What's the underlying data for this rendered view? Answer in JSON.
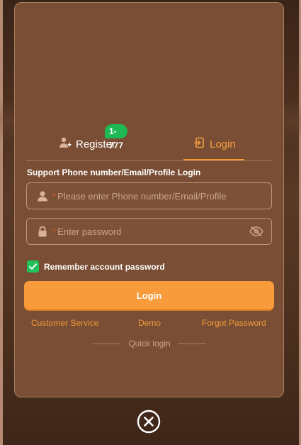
{
  "tabs": {
    "register_label": "Register",
    "register_badge": "1-777",
    "login_label": "Login"
  },
  "form": {
    "support_text": "Support Phone number/Email/Profile Login",
    "phone_required": "*",
    "phone_placeholder": "Please enter Phone number/Email/Profile",
    "password_required": "*",
    "password_placeholder": "Enter password",
    "remember_label": "Remember account password",
    "remember_checked": true,
    "login_button": "Login"
  },
  "links": {
    "customer_service": "Customer Service",
    "demo": "Demo",
    "forgot_password": "Forgot Password"
  },
  "quick_login": "Quick login",
  "colors": {
    "accent": "#f89b3a",
    "badge": "#1db954",
    "checkbox": "#20c05a",
    "modal_bg": "#7a4e34"
  },
  "icons": [
    "add-user-icon",
    "login-door-icon",
    "user-icon",
    "lock-icon",
    "eye-off-icon",
    "check-icon",
    "close-icon"
  ]
}
